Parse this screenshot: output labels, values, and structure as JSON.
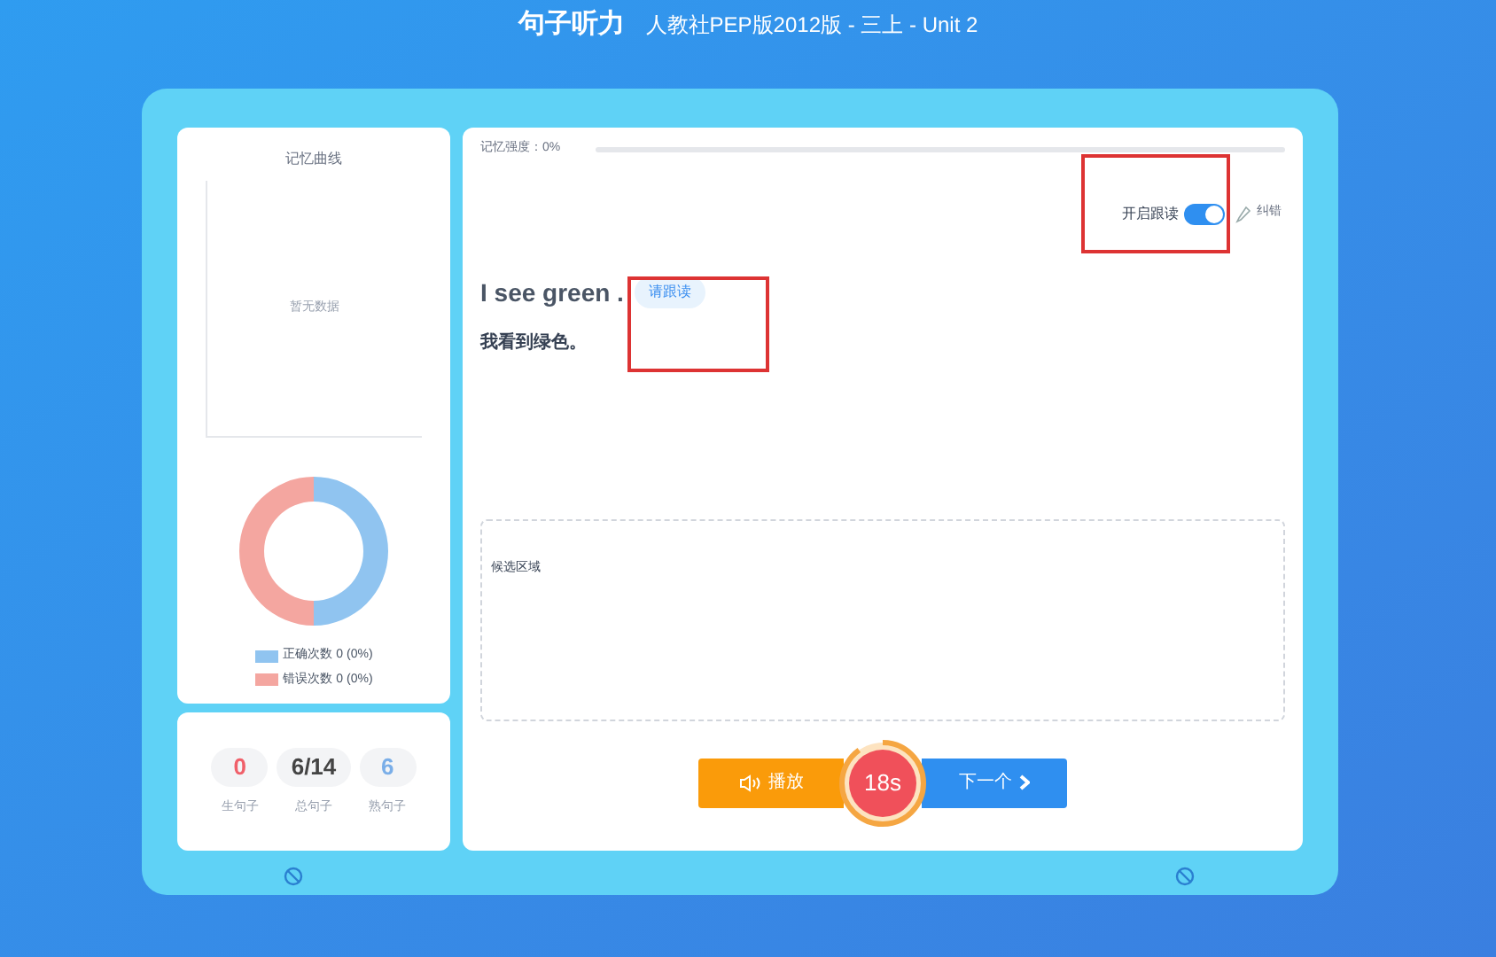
{
  "header": {
    "title": "句子听力",
    "subtitle": "人教社PEP版2012版 - 三上 - Unit 2"
  },
  "memory_curve": {
    "title": "记忆曲线",
    "empty_text": "暂无数据"
  },
  "legend": [
    {
      "label": "正确次数",
      "count": "0",
      "percent": "(0%)",
      "color": "#90c4f0"
    },
    {
      "label": "错误次数",
      "count": "0",
      "percent": "(0%)",
      "color": "#f4a6a0"
    }
  ],
  "stats": [
    {
      "value": "0",
      "label": "生句子",
      "color": "#f0606a"
    },
    {
      "value": "6/14",
      "label": "总句子",
      "color": "#444444"
    },
    {
      "value": "6",
      "label": "熟句子",
      "color": "#7aaee8"
    }
  ],
  "memory_strength": {
    "label": "记忆强度：0%",
    "level": 0
  },
  "follow_read": {
    "label": "开启跟读",
    "on": true
  },
  "report_error": {
    "label": "纠错"
  },
  "sentence": {
    "english": "I see green .",
    "badge": "请跟读",
    "chinese": "我看到绿色。"
  },
  "candidate_area": {
    "label": "候选区域"
  },
  "controls": {
    "play": "播放",
    "timer": "18s",
    "level": 0.9,
    "next": "下一个"
  }
}
